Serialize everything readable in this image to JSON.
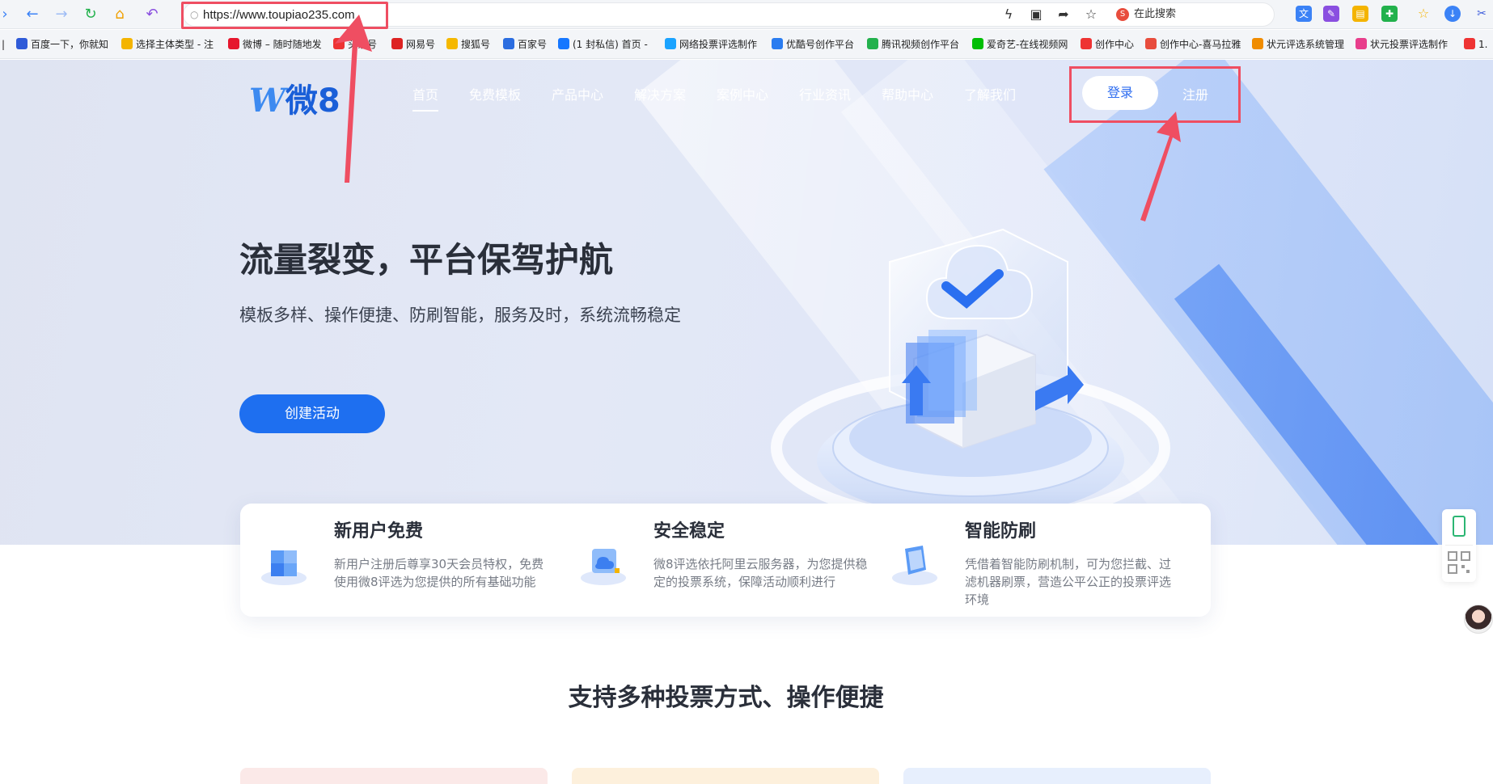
{
  "browser": {
    "url": "https://www.toupiao235.com",
    "search_placeholder": "在此搜索",
    "search_logo": "S"
  },
  "bookmarks": [
    {
      "label": "百度一下，你就知",
      "color": "#2f5bd8"
    },
    {
      "label": "选择主体类型 - 注",
      "color": "#f4b400"
    },
    {
      "label": "微博 – 随时随地发",
      "color": "#e6162d"
    },
    {
      "label": "头条号",
      "color": "#e33"
    },
    {
      "label": "网易号",
      "color": "#d22"
    },
    {
      "label": "搜狐号",
      "color": "#f5b800"
    },
    {
      "label": "百家号",
      "color": "#2b6de0"
    },
    {
      "label": "(1 封私信) 首页 -",
      "color": "#1677ff"
    },
    {
      "label": "网络投票评选制作",
      "color": "#1aa3ff"
    },
    {
      "label": "优酷号创作平台",
      "color": "#2a7cf0"
    },
    {
      "label": "腾讯视频创作平台",
      "color": "#23b14d"
    },
    {
      "label": "爱奇艺-在线视频网",
      "color": "#00be06"
    },
    {
      "label": "创作中心",
      "color": "#e33"
    },
    {
      "label": "创作中心-喜马拉雅",
      "color": "#e84d3d"
    },
    {
      "label": "状元评选系统管理",
      "color": "#f08c00"
    },
    {
      "label": "状元投票评选制作",
      "color": "#e83e8c"
    },
    {
      "label": "1.",
      "color": "#e33"
    }
  ],
  "site": {
    "logo_mark": "W",
    "logo_text": "微8",
    "nav": [
      "首页",
      "免费模板",
      "产品中心",
      "解决方案",
      "案例中心",
      "行业资讯",
      "帮助中心",
      "了解我们"
    ],
    "login_label": "登录",
    "register_label": "注册"
  },
  "hero": {
    "title": "流量裂变，平台保驾护航",
    "subtitle": "模板多样、操作便捷、防刷智能，服务及时，系统流畅稳定",
    "cta": "创建活动"
  },
  "features": [
    {
      "title": "新用户免费",
      "desc": "新用户注册后尊享30天会员特权，免费使用微8评选为您提供的所有基础功能"
    },
    {
      "title": "安全稳定",
      "desc": "微8评选依托阿里云服务器，为您提供稳定的投票系统，保障活动顺利进行"
    },
    {
      "title": "智能防刷",
      "desc": "凭借着智能防刷机制，可为您拦截、过滤机器刷票，营造公平公正的投票评选环境"
    }
  ],
  "section": {
    "title": "支持多种投票方式、操作便捷"
  },
  "colors": {
    "accent": "#1e6ff0",
    "highlight": "#ef4e62"
  }
}
